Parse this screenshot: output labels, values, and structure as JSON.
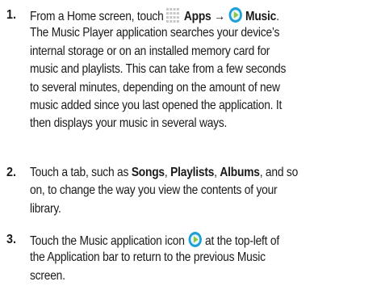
{
  "steps": [
    {
      "number": "1.",
      "line1": {
        "pre": "From a Home screen, touch",
        "apps_label": "Apps",
        "arrow": "→",
        "music_label": "Music",
        "end": "."
      },
      "body": [
        "The Music Player application searches your device’s",
        "internal storage or on an installed memory card for",
        "music and playlists. This can take from a few seconds",
        "to several minutes, depending on the amount of new",
        "music added since you last opened the application. It",
        "then displays your music in several ways."
      ]
    },
    {
      "number": "2.",
      "line1": {
        "pre": "Touch a tab, such as",
        "tab1": "Songs",
        "sep1": ",",
        "tab2": "Playlists",
        "sep2": ",",
        "tab3": "Albums",
        "post": ", and so"
      },
      "body": [
        "on, to change the way you view the contents of your",
        "library."
      ]
    },
    {
      "number": "3.",
      "line1": {
        "pre": "Touch the Music application icon",
        "post": "at the top-left of"
      },
      "body": [
        "the Application bar to return to the previous Music",
        "screen."
      ]
    }
  ],
  "icons": {
    "apps": "apps-grid-icon",
    "music": "music-app-icon"
  },
  "colors": {
    "text": "#1a1a1a",
    "apps_icon": "#c9c9c9",
    "music_icon_ring": "#1f9fd8",
    "music_icon_arrow": "#8cc63f"
  }
}
